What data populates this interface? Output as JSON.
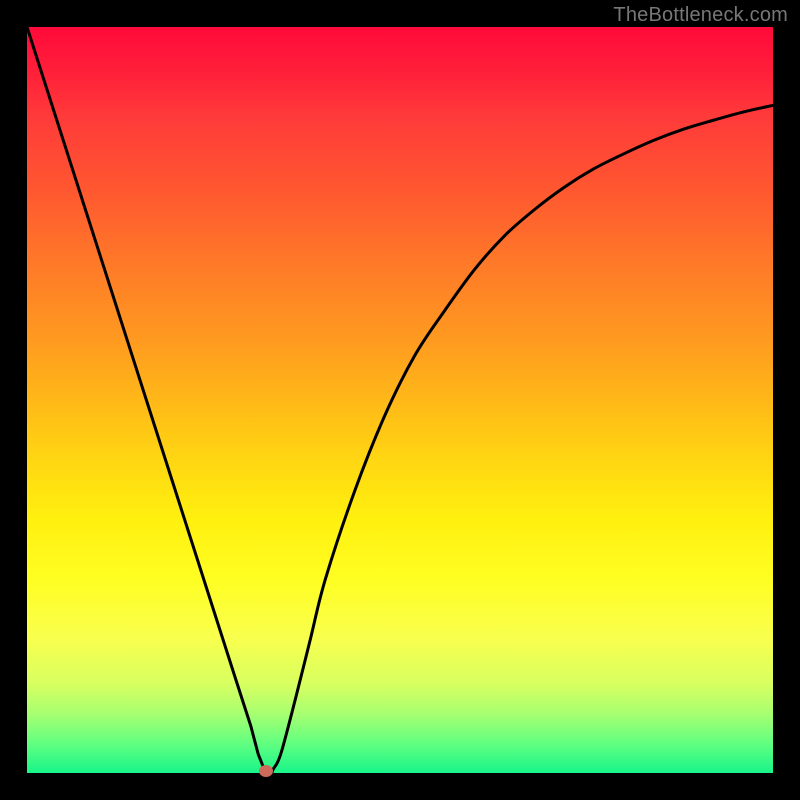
{
  "watermark": "TheBottleneck.com",
  "colors": {
    "background": "#000000",
    "gradient_top": "#ff0a3a",
    "gradient_bottom": "#18f58a",
    "curve": "#000000",
    "marker": "#cc6b5c"
  },
  "chart_data": {
    "type": "line",
    "title": "",
    "xlabel": "",
    "ylabel": "",
    "xlim": [
      0,
      100
    ],
    "ylim": [
      0,
      100
    ],
    "grid": false,
    "legend": false,
    "note": "Axes are implicit (no tick labels visible); x and y expressed as percent of plot area. The curve is a V-shaped function with a sharp minimum near x≈32, y≈0.",
    "series": [
      {
        "name": "curve",
        "x": [
          0,
          4,
          8,
          12,
          16,
          20,
          24,
          28,
          30,
          31,
          32,
          33,
          34,
          36,
          38,
          40,
          44,
          48,
          52,
          56,
          60,
          64,
          68,
          72,
          76,
          80,
          84,
          88,
          92,
          96,
          100
        ],
        "y": [
          100,
          87.5,
          75,
          62.5,
          50,
          37.5,
          25,
          12.5,
          6.3,
          2.5,
          0,
          0.5,
          2.5,
          10,
          18,
          26,
          38,
          48,
          56,
          62,
          67.5,
          72,
          75.5,
          78.5,
          81,
          83,
          84.8,
          86.3,
          87.5,
          88.6,
          89.5
        ]
      }
    ],
    "minimum_marker": {
      "x": 32,
      "y": 0
    }
  }
}
